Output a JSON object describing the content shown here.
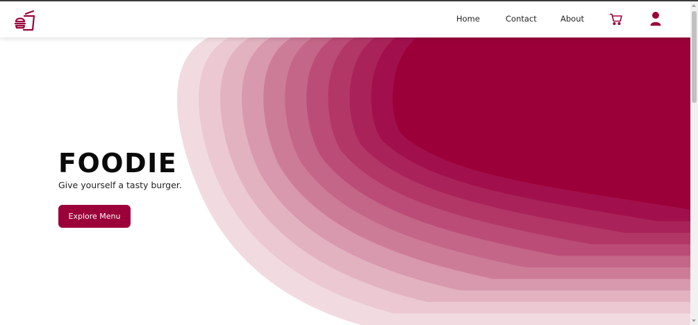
{
  "nav": {
    "links": [
      {
        "label": "Home"
      },
      {
        "label": "Contact"
      },
      {
        "label": "About"
      }
    ],
    "icons": [
      "burger-logo-icon",
      "cart-icon",
      "user-icon"
    ]
  },
  "hero": {
    "title": "FOODIE",
    "subtitle": "Give yourself a tasty burger.",
    "button_label": "Explore Menu"
  },
  "colors": {
    "brand": "#9c0038",
    "wave_layers": [
      "#f1dbe1",
      "#ebc8d2",
      "#e2b2c1",
      "#d898ad",
      "#cd7c98",
      "#c46687",
      "#bb4c77",
      "#b23767",
      "#a9235a",
      "#a1104d",
      "#9c0038"
    ]
  }
}
